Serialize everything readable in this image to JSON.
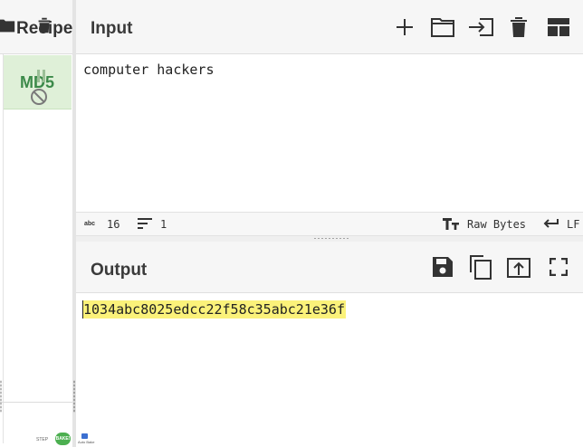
{
  "recipe": {
    "title": "Recipe",
    "operations": [
      {
        "name": "MD5",
        "state": "disabled"
      }
    ],
    "footer": {
      "step_label": "STEP",
      "bake_label": "BAKE!",
      "autobake_label": "Auto Bake",
      "autobake_checked": true
    }
  },
  "input": {
    "title": "Input",
    "text": "computer hackers",
    "header_icons": [
      "plus-icon",
      "folder-open-icon",
      "sign-in-icon",
      "trash-icon",
      "layout-icon"
    ],
    "status": {
      "length_icon": "abc",
      "length": "16",
      "lines": "1",
      "charset": "Raw Bytes",
      "eol": "LF"
    }
  },
  "output": {
    "title": "Output",
    "text": "1034abc8025edcc22f58c35abc21e36f",
    "header_icons": [
      "save-icon",
      "copy-icon",
      "replace-input-icon",
      "fullscreen-icon"
    ],
    "highlight_color": "#fbf27a"
  },
  "colors": {
    "operation_bg": "#dff0d8",
    "operation_text": "#3c8a4a",
    "header_bg": "#f6f6f6",
    "bake_green": "#4caf50"
  }
}
